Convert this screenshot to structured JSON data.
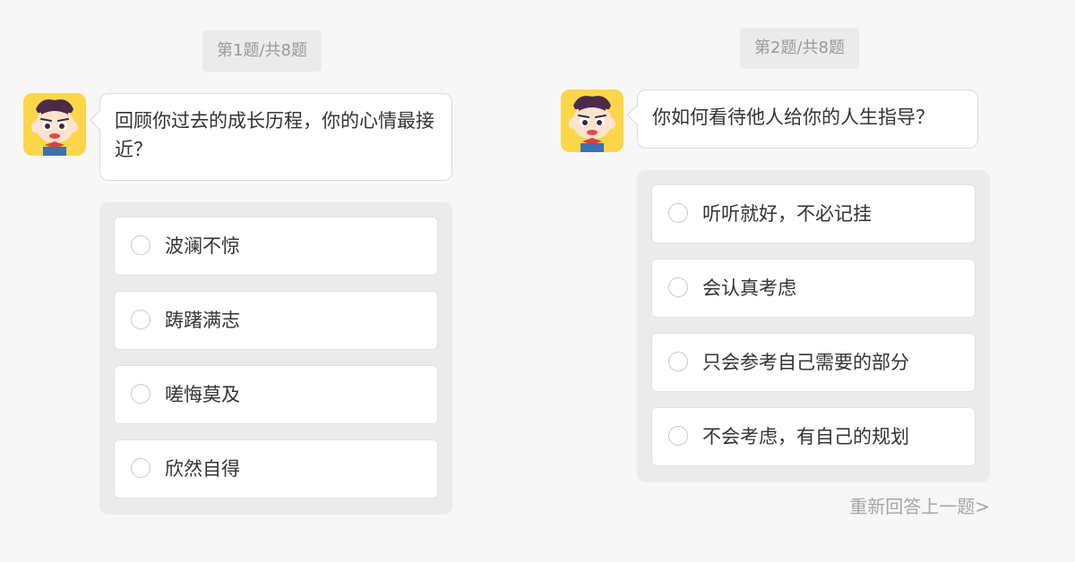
{
  "questions": [
    {
      "counter": "第1题/共8题",
      "question": "回顾你过去的成长历程，你的心情最接近？",
      "options": [
        "波澜不惊",
        "踌躇满志",
        "嗟悔莫及",
        "欣然自得"
      ]
    },
    {
      "counter": "第2题/共8题",
      "question": "你如何看待他人给你的人生指导？",
      "options": [
        "听听就好，不必记挂",
        "会认真考虑",
        "只会参考自己需要的部分",
        "不会考虑，有自己的规划"
      ]
    }
  ],
  "reanswer_link": "重新回答上一题>",
  "colors": {
    "background": "#f7f7f7",
    "counter_bg": "#ebebeb",
    "counter_text": "#999999",
    "options_bg": "#ebebeb",
    "option_bg": "#ffffff",
    "text": "#333333",
    "avatar_bg": "#fbd64a",
    "link": "#a6a6a6"
  }
}
